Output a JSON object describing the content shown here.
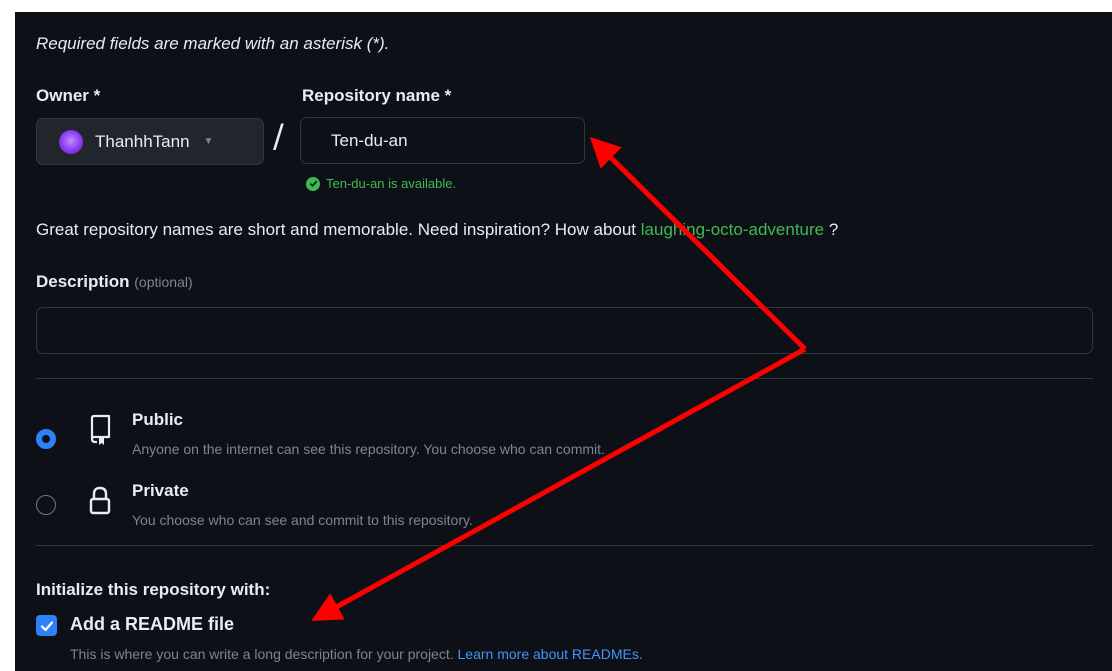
{
  "form": {
    "required_note": "Required fields are marked with an asterisk (*).",
    "owner_label": "Owner *",
    "owner_value": "ThanhhTann",
    "separator": "/",
    "repo_name_label": "Repository name *",
    "repo_name_value": "Ten-du-an",
    "availability_msg": "Ten-du-an is available.",
    "inspiration_text": "Great repository names are short and memorable. Need inspiration? How about ",
    "suggestion": "laughing-octo-adventure",
    "suggestion_suffix": " ?",
    "description_label": "Description",
    "description_optional": "(optional)",
    "description_value": ""
  },
  "visibility": {
    "selected": "public",
    "options": [
      {
        "title": "Public",
        "desc": "Anyone on the internet can see this repository. You choose who can commit."
      },
      {
        "title": "Private",
        "desc": "You choose who can see and commit to this repository."
      }
    ]
  },
  "init": {
    "heading": "Initialize this repository with:",
    "readme_label": "Add a README file",
    "readme_checked": true,
    "readme_desc": "This is where you can write a long description for your project. ",
    "readme_link": "Learn more about READMEs."
  },
  "colors": {
    "background": "#0d1117",
    "accent_blue": "#2f81f7",
    "success_green": "#3fb950",
    "annotation_arrow": "#ff0000"
  },
  "icons": [
    "avatar",
    "chevron-down-icon",
    "check-circle-icon",
    "repo-icon",
    "lock-icon",
    "checkmark-icon"
  ]
}
